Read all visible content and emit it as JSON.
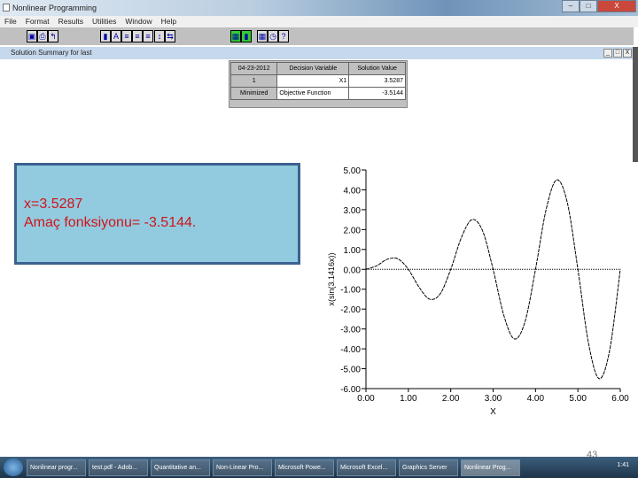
{
  "window": {
    "title": "Nonlinear Programming",
    "controls": [
      "minimize",
      "maximize",
      "close"
    ]
  },
  "menu": [
    "File",
    "Format",
    "Results",
    "Utilities",
    "Window",
    "Help"
  ],
  "toolbar": {
    "icons": [
      "save-icon",
      "print-icon",
      "exit-icon",
      "bar-chart-icon",
      "font-icon",
      "align-left-icon",
      "align-center-icon",
      "align-right-icon",
      "row-height-icon",
      "column-width-icon",
      "grid-icon",
      "graph-icon",
      "calculator-icon",
      "clock-icon",
      "help-icon"
    ],
    "glyphs": [
      "▣",
      "⎙",
      "↰",
      "▮",
      "A",
      "≡",
      "≡",
      "≡",
      "↕",
      "⇆",
      "▦",
      "▮",
      "▦",
      "◷",
      "?"
    ]
  },
  "child_window": {
    "title": "Solution Summary for last"
  },
  "solution_table": {
    "headers": [
      "04-23-2012",
      "Decision Variable",
      "Solution Value"
    ],
    "rows": [
      [
        "1",
        "X1",
        "3.5287"
      ],
      [
        "Minimized",
        "Objective Function",
        "-3.5144"
      ]
    ]
  },
  "result_box": {
    "line1": "x=3.5287",
    "line2": "Amaç fonksiyonu= -3.5144."
  },
  "chart_data": {
    "type": "line",
    "xlabel": "X",
    "ylabel": "x(sin(3.1416x))",
    "xlim": [
      0,
      6
    ],
    "ylim": [
      -6,
      5
    ],
    "xticks": [
      "0.00",
      "1.00",
      "2.00",
      "3.00",
      "4.00",
      "5.00",
      "6.00"
    ],
    "yticks": [
      "5.00",
      "4.00",
      "3.00",
      "2.00",
      "1.00",
      "0.00",
      "-1.00",
      "-2.00",
      "-3.00",
      "-4.00",
      "-5.00",
      "-6.00"
    ],
    "series": [
      {
        "x": [
          0,
          0.25,
          0.5,
          0.75,
          1,
          1.25,
          1.5,
          1.75,
          2,
          2.25,
          2.5,
          2.75,
          3,
          3.25,
          3.5,
          3.75,
          4,
          4.25,
          4.5,
          4.75,
          5,
          5.25,
          5.5,
          5.75,
          6
        ],
        "y": [
          0,
          0.177,
          0.5,
          0.53,
          0,
          -0.884,
          -1.5,
          -1.237,
          0,
          1.591,
          2.5,
          1.945,
          0,
          -2.298,
          -3.5,
          -2.652,
          0,
          3.005,
          4.5,
          3.359,
          0,
          -3.712,
          -5.5,
          -4.066,
          0
        ]
      }
    ],
    "zero_line": true,
    "grid": false
  },
  "page_number": "43",
  "taskbar": {
    "items": [
      "Nonlinear progr...",
      "test.pdf - Adob...",
      "Quantitative an...",
      "Non-Linear Pro...",
      "Microsoft Powe...",
      "Microsoft Excel...",
      "Graphics Server",
      "Nonlinear Prog..."
    ],
    "active": 7,
    "clock": "1:41"
  }
}
